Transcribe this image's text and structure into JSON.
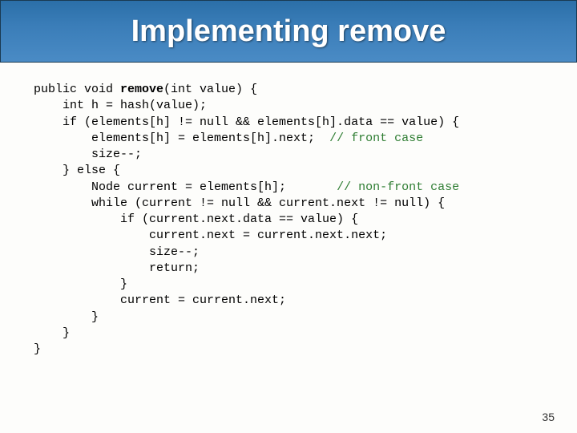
{
  "title": "Implementing remove",
  "code": {
    "l1a": "public void ",
    "l1b": "remove",
    "l1c": "(int value) {",
    "l2": "    int h = hash(value);",
    "l3": "    if (elements[h] != null && elements[h].data == value) {",
    "l4a": "        elements[h] = elements[h].next;  ",
    "l4b": "// front case",
    "l5": "        size--;",
    "l6": "    } else {",
    "l7a": "        Node current = elements[h];       ",
    "l7b": "// non-front case",
    "l8": "        while (current != null && current.next != null) {",
    "l9": "            if (current.next.data == value) {",
    "l10": "                current.next = current.next.next;",
    "l11": "                size--;",
    "l12": "                return;",
    "l13": "            }",
    "l14": "            current = current.next;",
    "l15": "        }",
    "l16": "    }",
    "l17": "}"
  },
  "slide_number": "35"
}
